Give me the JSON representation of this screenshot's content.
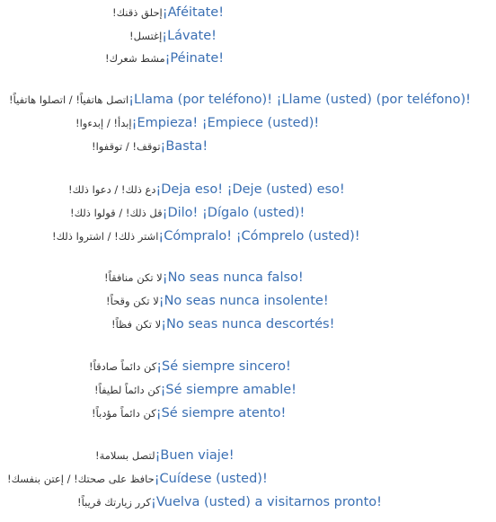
{
  "rows": [
    {
      "arabic": "إحلق ذقنك!",
      "spanish": "¡Aféitate!"
    },
    {
      "arabic": "إغتسل!",
      "spanish": "¡Lávate!"
    },
    {
      "arabic": "مشط شعرك!",
      "spanish": "¡Péinate!"
    },
    {
      "arabic": "اتصل هاتفياً! / اتصلوا هاتفياً!",
      "spanish": "¡Llama (por teléfono)! ¡Llame (usted) (por teléfono)!"
    },
    {
      "arabic": "إبدأ! / إبدءوا!",
      "spanish": "¡Empieza! ¡Empiece (usted)!"
    },
    {
      "arabic": "توقف! / توقفوا!",
      "spanish": "¡Basta!"
    },
    {
      "arabic": "دع ذلك! / دعوا ذلك!",
      "spanish": "¡Deja eso! ¡Deje (usted) eso!"
    },
    {
      "arabic": "قل ذلك! / قولوا ذلك!",
      "spanish": "¡Dilo! ¡Dígalo (usted)!"
    },
    {
      "arabic": "اشتر ذلك! / اشتروا ذلك!",
      "spanish": "¡Cómpralo! ¡Cómprelo (usted)!"
    },
    {
      "arabic": "لا تكن منافقاً!",
      "spanish": "¡No seas nunca falso!"
    },
    {
      "arabic": "لا تكن وقحاً!",
      "spanish": "¡No seas nunca insolente!"
    },
    {
      "arabic": "لا تكن فظاً!",
      "spanish": "¡No seas nunca descortés!"
    },
    {
      "arabic": "كن دائماً صادقاً!",
      "spanish": "¡Sé siempre sincero!"
    },
    {
      "arabic": "كن دائماً لطيفاً!",
      "spanish": "¡Sé siempre amable!"
    },
    {
      "arabic": "كن دائماً مؤدباً!",
      "spanish": "¡Sé siempre atento!"
    },
    {
      "arabic": "لتصل بسلامة!",
      "spanish": "¡Buen viaje!"
    },
    {
      "arabic": "حافظ على صحتك! / إعتن بنفسك!",
      "spanish": "¡Cuídese (usted)!"
    },
    {
      "arabic": "كرر زيارتك قريباً!",
      "spanish": "¡Vuelva (usted) a visitarnos pronto!"
    }
  ]
}
